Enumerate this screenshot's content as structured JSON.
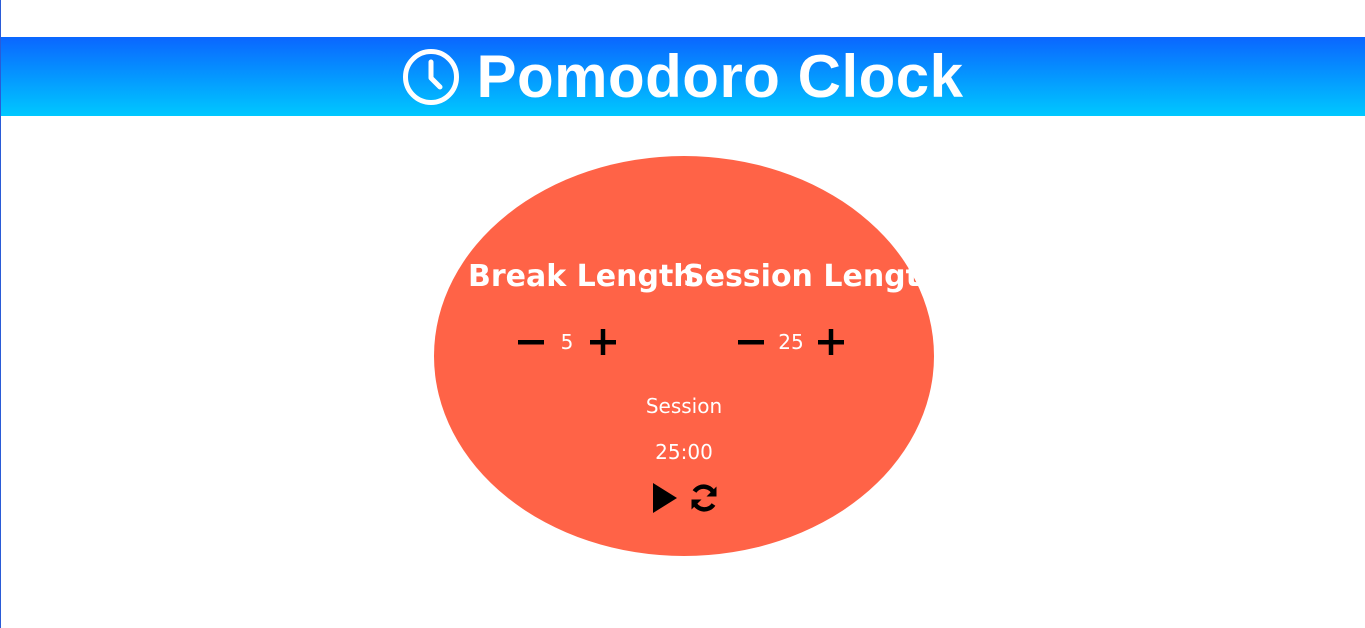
{
  "app": {
    "title": "Pomodoro Clock",
    "header_gradient": [
      "#0a66ff",
      "#00c8ff"
    ],
    "accent": "#ff6347"
  },
  "break": {
    "label": "Break Length",
    "value": "5",
    "decrement_icon": "minus-icon",
    "increment_icon": "plus-icon"
  },
  "session": {
    "label": "Session Length",
    "value": "25",
    "decrement_icon": "minus-icon",
    "increment_icon": "plus-icon"
  },
  "timer": {
    "status": "Session",
    "time": "25:00",
    "play_icon": "play-icon",
    "reset_icon": "refresh-icon"
  }
}
